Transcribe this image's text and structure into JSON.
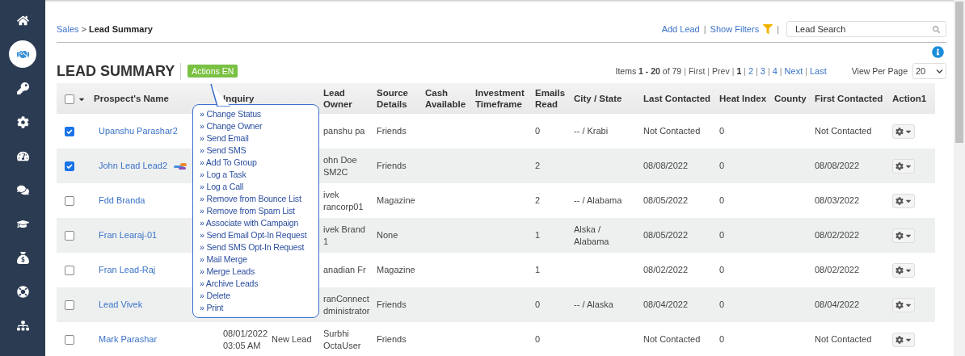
{
  "sidebar": {
    "items": [
      {
        "selected": false
      },
      {
        "selected": true
      },
      {
        "selected": false
      },
      {
        "selected": false
      },
      {
        "selected": false
      },
      {
        "selected": false
      },
      {
        "selected": false
      },
      {
        "selected": false
      },
      {
        "selected": false
      },
      {
        "selected": false
      }
    ]
  },
  "breadcrumb": {
    "parent": "Sales",
    "separator": ">",
    "current": "Lead Summary"
  },
  "toolbar": {
    "separator": "|",
    "add_lead": "Add Lead",
    "show_filters": "Show Filters",
    "search": {
      "placeholder": "Lead Search"
    }
  },
  "title": "LEAD SUMMARY",
  "actions_button": "Actions EN",
  "pagination": {
    "separator": "|",
    "summary": "Items **1 - 20** of 79",
    "pages": [
      {
        "label": "First",
        "kind": "plain"
      },
      {
        "label": "Prev",
        "kind": "plain"
      },
      {
        "label": "1",
        "kind": "current"
      },
      {
        "label": "2",
        "kind": "link"
      },
      {
        "label": "3",
        "kind": "link"
      },
      {
        "label": "4",
        "kind": "link"
      },
      {
        "label": "Next",
        "kind": "link"
      },
      {
        "label": "Last",
        "kind": "link"
      }
    ],
    "view_per_page": {
      "label": "View Per Page",
      "value": "20"
    }
  },
  "actions_menu": {
    "bullet": "»",
    "items": [
      "Change Status",
      "Change Owner",
      "Send Email",
      "Send SMS",
      "Add To Group",
      "Log a Task",
      "Log a Call",
      "Remove from Bounce List",
      "Remove from Spam List",
      "Associate with Campaign",
      "Send Email Opt-In Request",
      "Send SMS Opt-In Request",
      "Mail Merge",
      "Merge Leads",
      "Archive Leads",
      "Delete",
      "Print"
    ]
  },
  "table": {
    "select_all": {
      "checked": false
    },
    "columns": [
      "Prospect's Name",
      "Inquiry",
      "Lead Owner",
      "Source Details",
      "Cash Available",
      "Investment Timeframe",
      "Emails Read",
      "City / State",
      "Last Contacted",
      "Heat Index",
      "County",
      "First Contacted",
      "Action1"
    ],
    "rows": [
      {
        "checked": true,
        "marked": false,
        "name": "Upanshu Parashar2",
        "lead_owner": "panshu pa",
        "source_details": "Friends",
        "emails_read": "0",
        "city_state": "-- / Krabi",
        "last_contacted": "Not Contacted",
        "heat_index": "0",
        "first_contacted": "Not Contacted"
      },
      {
        "checked": true,
        "marked": true,
        "name": "John Lead Lead2",
        "lead_owner": "ohn Doe SM2C",
        "source_details": "Friends",
        "emails_read": "2",
        "last_contacted": "08/08/2022",
        "heat_index": "0",
        "first_contacted": "08/08/2022"
      },
      {
        "checked": false,
        "marked": false,
        "name": "Fdd Branda",
        "lead_owner": "ivek rancorp01",
        "source_details": "Magazine",
        "emails_read": "2",
        "city_state": "-- / Alabama",
        "last_contacted": "08/05/2022",
        "heat_index": "0",
        "first_contacted": "08/03/2022"
      },
      {
        "checked": false,
        "marked": false,
        "name": "Fran Learaj-01",
        "lead_owner": "ivek Brand 1",
        "source_details": "None",
        "emails_read": "1",
        "city_state": "Alska / Alabama",
        "last_contacted": "08/05/2022",
        "heat_index": "0",
        "first_contacted": "08/02/2022"
      },
      {
        "checked": false,
        "marked": false,
        "name": "Fran Lead-Raj",
        "lead_owner": "anadian Fr",
        "source_details": "Magazine",
        "emails_read": "1",
        "last_contacted": "08/02/2022",
        "heat_index": "0",
        "first_contacted": "08/02/2022"
      },
      {
        "checked": false,
        "marked": false,
        "name": "Lead Vivek",
        "lead_owner": "ranConnect dministrator",
        "source_details": "Friends",
        "emails_read": "0",
        "city_state": "-- / Alaska",
        "last_contacted": "08/04/2022",
        "heat_index": "0",
        "first_contacted": "08/04/2022"
      },
      {
        "checked": false,
        "marked": false,
        "name": "Mark Parashar",
        "inquiry": "08/01/2022 03:05 AM",
        "column_3": "New Lead",
        "lead_owner": "Surbhi OctaUser",
        "source_details": "Friends",
        "emails_read": "0",
        "last_contacted": "Not Contacted",
        "heat_index": "0",
        "first_contacted": "Not Contacted"
      }
    ]
  }
}
